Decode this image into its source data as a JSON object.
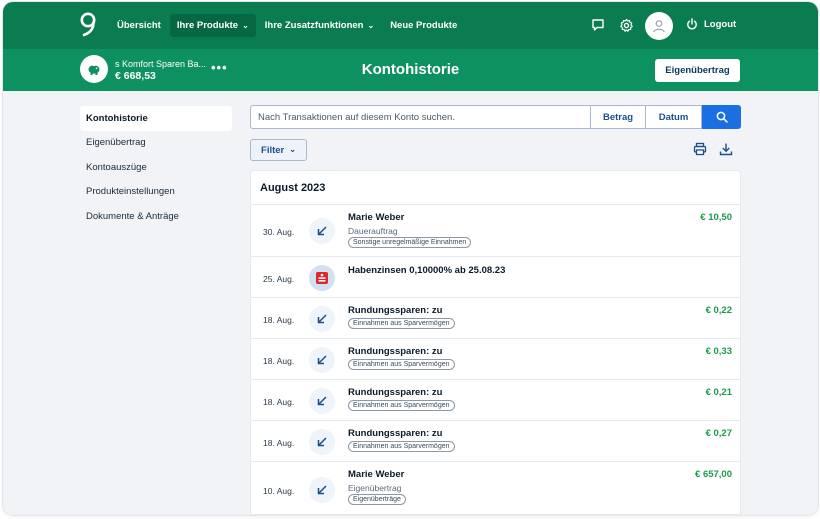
{
  "nav": {
    "items": [
      {
        "label": "Übersicht"
      },
      {
        "label": "Ihre Produkte"
      },
      {
        "label": "Ihre Zusatzfunktionen"
      },
      {
        "label": "Neue Produkte"
      }
    ],
    "logout": "Logout"
  },
  "account": {
    "name": "s Komfort Sparen Ba...",
    "balance": "€ 668,53",
    "more": "•••"
  },
  "header": {
    "title": "Kontohistorie",
    "transfer_button": "Eigenübertrag"
  },
  "sidebar": {
    "items": [
      {
        "label": "Kontohistorie"
      },
      {
        "label": "Eigenübertrag"
      },
      {
        "label": "Kontoauszüge"
      },
      {
        "label": "Produkteinstellungen"
      },
      {
        "label": "Dokumente & Anträge"
      }
    ]
  },
  "search": {
    "placeholder": "Nach Transaktionen auf diesem Konto suchen.",
    "amount_button": "Betrag",
    "date_button": "Datum"
  },
  "filter": {
    "label": "Filter"
  },
  "month": "August 2023",
  "transactions": [
    {
      "date": "30. Aug.",
      "title": "Marie Weber",
      "sub": "Dauerauftrag",
      "tag": "Sonstige unregelmäßige Einnahmen",
      "amount": "€ 10,50",
      "icon": "arrow-down-left-icon"
    },
    {
      "date": "25. Aug.",
      "title": "Habenzinsen 0,10000% ab 25.08.23",
      "sub": "",
      "tag": "",
      "amount": "",
      "icon": "sparkasse-icon"
    },
    {
      "date": "18. Aug.",
      "title": "Rundungssparen: zu",
      "sub": "",
      "tag": "Einnahmen aus Sparvermögen",
      "amount": "€ 0,22",
      "icon": "arrow-down-left-icon"
    },
    {
      "date": "18. Aug.",
      "title": "Rundungssparen: zu",
      "sub": "",
      "tag": "Einnahmen aus Sparvermögen",
      "amount": "€ 0,33",
      "icon": "arrow-down-left-icon"
    },
    {
      "date": "18. Aug.",
      "title": "Rundungssparen: zu",
      "sub": "",
      "tag": "Einnahmen aus Sparvermögen",
      "amount": "€ 0,21",
      "icon": "arrow-down-left-icon"
    },
    {
      "date": "18. Aug.",
      "title": "Rundungssparen: zu",
      "sub": "",
      "tag": "Einnahmen aus Sparvermögen",
      "amount": "€ 0,27",
      "icon": "arrow-down-left-icon"
    },
    {
      "date": "10. Aug.",
      "title": "Marie Weber",
      "sub": "Eigenübertrag",
      "tag": "Eigenüberträge",
      "amount": "€ 657,00",
      "icon": "arrow-down-left-icon"
    }
  ],
  "colors": {
    "nav_bg": "#0a7c4f",
    "subbar_bg": "#0e9160",
    "accent_blue": "#1b6fe0",
    "amount_green": "#1a9a4a",
    "sparkasse_red": "#e3222a"
  }
}
